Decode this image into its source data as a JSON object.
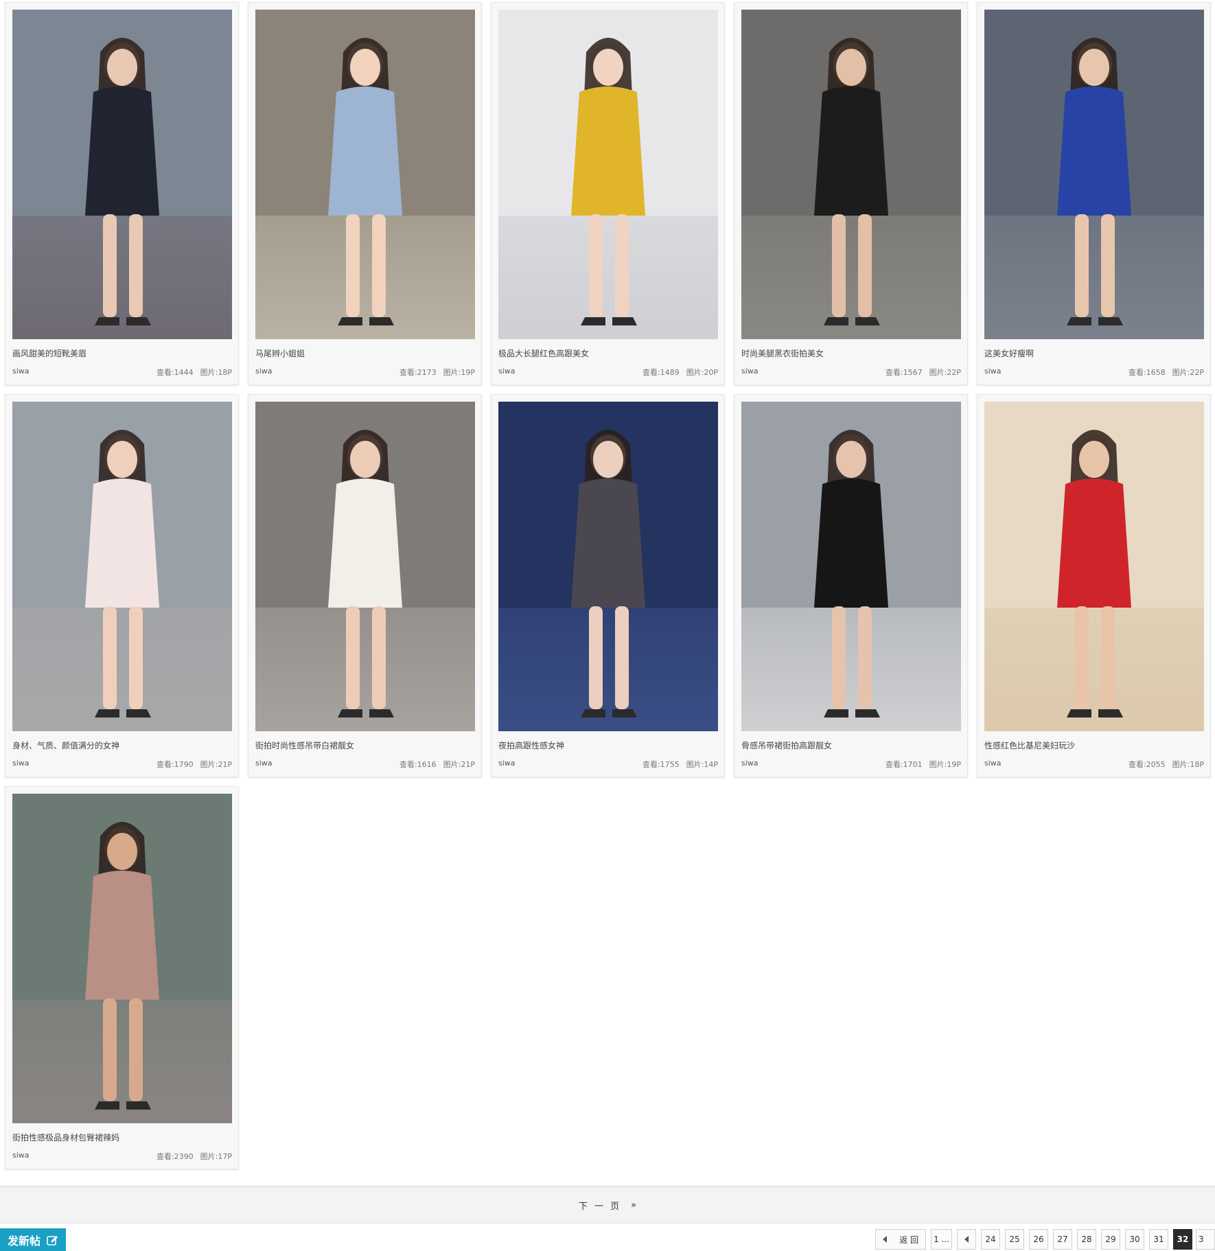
{
  "gallery": {
    "items": [
      {
        "title": "画风甜美的短靴美眉",
        "author": "siwa",
        "views": "查看:1444",
        "pics": "图片:18P",
        "palette": {
          "bg": "#7d8794",
          "ground": "#6f6a72",
          "outfit": "#1f2430",
          "skin": "#e9c9b3"
        }
      },
      {
        "title": "马尾辫小姐姐",
        "author": "siwa",
        "views": "查看:2173",
        "pics": "图片:19P",
        "palette": {
          "bg": "#8c8478",
          "ground": "#b9b2a4",
          "outfit": "#9db4d3",
          "skin": "#f0d2bd"
        }
      },
      {
        "title": "极品大长腿红色高跟美女",
        "author": "siwa",
        "views": "查看:1489",
        "pics": "图片:20P",
        "palette": {
          "bg": "#e7e7ea",
          "ground": "#cfcfd4",
          "outfit": "#e0b52a",
          "skin": "#f1d3c1"
        }
      },
      {
        "title": "时尚美腿黑衣街拍美女",
        "author": "siwa",
        "views": "查看:1567",
        "pics": "图片:22P",
        "palette": {
          "bg": "#6e6c6b",
          "ground": "#8a8884",
          "outfit": "#1c1c1c",
          "skin": "#e2bfa6"
        }
      },
      {
        "title": "这美女好瘦啊",
        "author": "siwa",
        "views": "查看:1658",
        "pics": "图片:22P",
        "palette": {
          "bg": "#5d6573",
          "ground": "#7b828d",
          "outfit": "#2843a6",
          "skin": "#e8c6ad"
        }
      },
      {
        "title": "身材、气质、颜值满分的女神",
        "author": "siwa",
        "views": "查看:1790",
        "pics": "图片:21P",
        "palette": {
          "bg": "#9aa0a8",
          "ground": "#a8a8a8",
          "outfit": "#f3e4e4",
          "skin": "#f0d0bc"
        }
      },
      {
        "title": "街拍时尚性感吊带白裙靓女",
        "author": "siwa",
        "views": "查看:1616",
        "pics": "图片:21P",
        "palette": {
          "bg": "#7f7b78",
          "ground": "#a7a39e",
          "outfit": "#f1efe8",
          "skin": "#edcdb8"
        }
      },
      {
        "title": "夜拍高跟性感女神",
        "author": "siwa",
        "views": "查看:1755",
        "pics": "图片:14P",
        "palette": {
          "bg": "#24335f",
          "ground": "#3a4f86",
          "outfit": "#4b4750",
          "skin": "#eccfbf"
        }
      },
      {
        "title": "骨感吊带裙街拍高跟靓女",
        "author": "siwa",
        "views": "查看:1701",
        "pics": "图片:19P",
        "palette": {
          "bg": "#9aa0a6",
          "ground": "#cfd0d2",
          "outfit": "#161616",
          "skin": "#e6c3ad"
        }
      },
      {
        "title": "性感红色比基尼美妇玩沙",
        "author": "siwa",
        "views": "查看:2055",
        "pics": "图片:18P",
        "palette": {
          "bg": "#e7d9c4",
          "ground": "#dcc9ac",
          "outfit": "#d0242b",
          "skin": "#e8c4a8"
        }
      },
      {
        "title": "街拍性感极品身材包臀裙辣妈",
        "author": "siwa",
        "views": "查看:2390",
        "pics": "图片:17P",
        "palette": {
          "bg": "#6b7a72",
          "ground": "#8a8583",
          "outfit": "#b98f86",
          "skin": "#d7aa8c"
        }
      }
    ]
  },
  "next_page": {
    "label": "下 一 页",
    "arrow": "»"
  },
  "post_button": {
    "label": "发新帖",
    "icon": "edit-icon"
  },
  "pagination": {
    "back_label": "返 回",
    "first": "1 ...",
    "pages": [
      "24",
      "25",
      "26",
      "27",
      "28",
      "29",
      "30",
      "31"
    ],
    "current": "32",
    "cut_next": "3"
  }
}
